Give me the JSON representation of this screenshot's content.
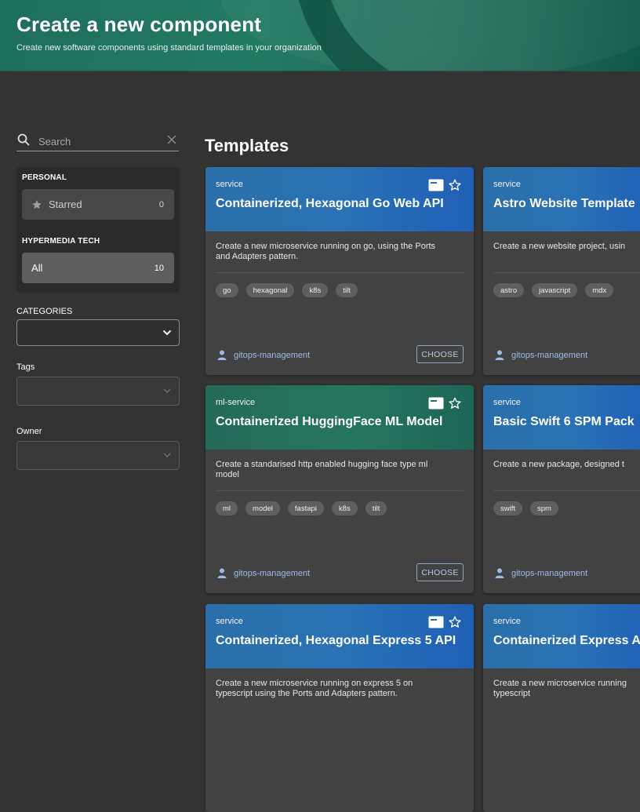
{
  "header": {
    "title": "Create a new component",
    "subtitle": "Create new software components using standard templates in your organization"
  },
  "search": {
    "placeholder": "Search"
  },
  "filters": {
    "personal_label": "PERSONAL",
    "starred_label": "Starred",
    "starred_count": "0",
    "group_label": "HYPERMEDIA TECH",
    "all_label": "All",
    "all_count": "10",
    "categories_label": "CATEGORIES",
    "tags_label": "Tags",
    "owner_label": "Owner"
  },
  "main": {
    "title": "Templates",
    "choose_label": "CHOOSE",
    "cards": [
      {
        "kind": "service",
        "name": "Containerized, Hexagonal Go Web API",
        "desc": "Create a new microservice running on go, using the Ports and Adapters pattern.",
        "tags": [
          "go",
          "hexagonal",
          "k8s",
          "tilt"
        ],
        "owner": "gitops-management",
        "color": "#2a6fb0"
      },
      {
        "kind": "service",
        "name": "Astro Website Template",
        "desc": "Create a new website project, usin",
        "tags": [
          "astro",
          "javascript",
          "mdx"
        ],
        "owner": "gitops-management",
        "color": "#2a6fb0"
      },
      {
        "kind": "ml-service",
        "name": "Containerized HuggingFace ML Model",
        "desc": "Create a standarised http enabled hugging face type ml model",
        "tags": [
          "ml",
          "model",
          "fastapi",
          "k8s",
          "tilt"
        ],
        "owner": "gitops-management",
        "color": "#25705c"
      },
      {
        "kind": "service",
        "name": "Basic Swift 6 SPM Pack",
        "desc": "Create a new package, designed t",
        "tags": [
          "swift",
          "spm"
        ],
        "owner": "gitops-management",
        "color": "#2a6fb0"
      },
      {
        "kind": "service",
        "name": "Containerized, Hexagonal Express 5 API",
        "desc": "Create a new microservice running on express 5 on typescript using the Ports and Adapters pattern.",
        "color": "#2a6fb0"
      },
      {
        "kind": "service",
        "name": "Containerized Express A",
        "desc": "Create a new microservice running typescript",
        "color": "#2a6fb0"
      }
    ]
  },
  "colors": {
    "header_green": "#237a63",
    "card_blue": "#2a6fb0",
    "card_green": "#25705c",
    "owner_link": "#9dbde6"
  }
}
